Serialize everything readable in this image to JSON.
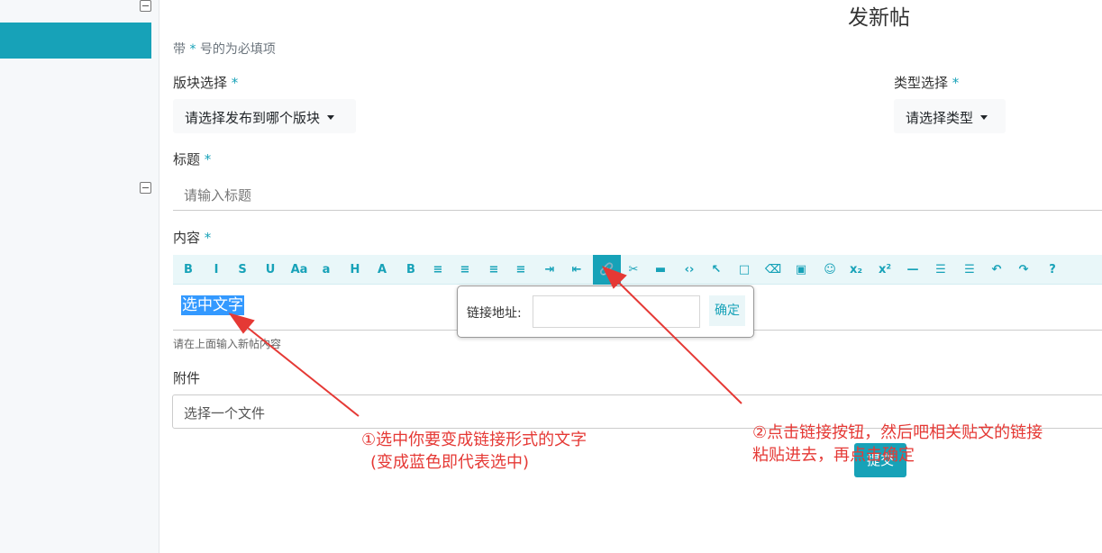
{
  "page": {
    "title": "发新帖"
  },
  "form": {
    "required_hint_prefix": "带",
    "required_hint_star": "*",
    "required_hint_suffix": "号的为必填项",
    "board_label": "版块选择",
    "board_placeholder": "请选择发布到哪个版块",
    "type_label": "类型选择",
    "type_placeholder": "请选择类型",
    "title_label": "标题",
    "title_placeholder": "请输入标题",
    "content_label": "内容",
    "content_help": "请在上面输入新帖内容",
    "attachment_label": "附件",
    "attachment_placeholder": "选择一个文件",
    "submit_label": "提交",
    "required_star": "*"
  },
  "editor": {
    "selected_text": "选中文字",
    "tooltip": "链接",
    "link_popover": {
      "label": "链接地址:",
      "confirm": "确定"
    },
    "toolbar": [
      {
        "name": "bold-icon",
        "glyph": "B"
      },
      {
        "name": "italic-icon",
        "glyph": "I"
      },
      {
        "name": "strikethrough-icon",
        "glyph": "S"
      },
      {
        "name": "underline-icon",
        "glyph": "U"
      },
      {
        "name": "font-size-icon",
        "glyph": "Aa"
      },
      {
        "name": "font-name-icon",
        "glyph": "a"
      },
      {
        "name": "heading-icon",
        "glyph": "H"
      },
      {
        "name": "font-color-icon",
        "glyph": "A"
      },
      {
        "name": "back-color-icon",
        "glyph": "B"
      },
      {
        "name": "align-center-icon",
        "glyph": "≡"
      },
      {
        "name": "align-left-icon",
        "glyph": "≡"
      },
      {
        "name": "align-right-icon",
        "glyph": "≡"
      },
      {
        "name": "align-justify-icon",
        "glyph": "≡"
      },
      {
        "name": "indent-icon",
        "glyph": "⇥"
      },
      {
        "name": "outdent-icon",
        "glyph": "⇤"
      },
      {
        "name": "link-icon",
        "glyph": "🔗"
      },
      {
        "name": "unlink-icon",
        "glyph": "✂"
      },
      {
        "name": "html-icon",
        "glyph": "▬"
      },
      {
        "name": "code-icon",
        "glyph": "‹›"
      },
      {
        "name": "cursor-icon",
        "glyph": "↖"
      },
      {
        "name": "box-icon",
        "glyph": "□"
      },
      {
        "name": "clear-format-icon",
        "glyph": "⌫"
      },
      {
        "name": "image-icon",
        "glyph": "▣"
      },
      {
        "name": "emoji-icon",
        "glyph": "☺"
      },
      {
        "name": "subscript-icon",
        "glyph": "x₂"
      },
      {
        "name": "superscript-icon",
        "glyph": "x²"
      },
      {
        "name": "horizontal-rule-icon",
        "glyph": "—"
      },
      {
        "name": "ordered-list-icon",
        "glyph": "☰"
      },
      {
        "name": "unordered-list-icon",
        "glyph": "☰"
      },
      {
        "name": "undo-icon",
        "glyph": "↶"
      },
      {
        "name": "redo-icon",
        "glyph": "↷"
      },
      {
        "name": "help-icon",
        "glyph": "?"
      }
    ]
  },
  "annotations": {
    "left_line1": "①选中你要变成链接形式的文字",
    "left_line2": "(变成蓝色即代表选中)",
    "right_line1": "②点击链接按钮，然后吧相关贴文的链接",
    "right_line2": "粘贴进去，再点击确定"
  },
  "colors": {
    "accent": "#17a2b8",
    "annotation": "#e53935",
    "selection": "#3399ff"
  }
}
